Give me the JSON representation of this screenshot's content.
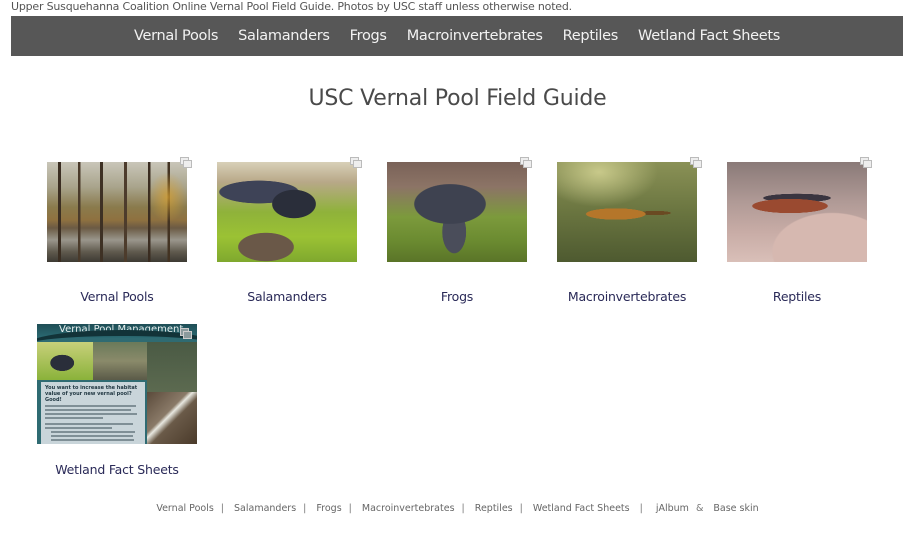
{
  "caption": "Upper Susquehanna Coalition Online Vernal Pool Field Guide. Photos by USC staff unless otherwise noted.",
  "nav": {
    "items": [
      {
        "label": "Vernal Pools"
      },
      {
        "label": "Salamanders"
      },
      {
        "label": "Frogs"
      },
      {
        "label": "Macroinvertebrates"
      },
      {
        "label": "Reptiles"
      },
      {
        "label": "Wetland Fact Sheets"
      }
    ]
  },
  "page_title": "USC Vernal Pool Field Guide",
  "albums": [
    {
      "label": "Vernal Pools",
      "image": "forest pool scene",
      "icon": "album-stack-icon"
    },
    {
      "label": "Salamanders",
      "image": "spotted salamander on moss",
      "icon": "album-stack-icon"
    },
    {
      "label": "Frogs",
      "image": "wood frog on moss",
      "icon": "album-stack-icon"
    },
    {
      "label": "Macroinvertebrates",
      "image": "fairy shrimp in water",
      "icon": "album-stack-icon"
    },
    {
      "label": "Reptiles",
      "image": "five-lined skink on hand",
      "icon": "album-stack-icon"
    },
    {
      "label": "Wetland Fact Sheets",
      "image": "vernal pool management fact sheet",
      "icon": "album-stack-icon",
      "sheet_header": "Vernal Pool Management",
      "sheet_heading": "You want to increase the habitat value of your new vernal pool? Good!"
    }
  ],
  "footer": {
    "links": [
      {
        "label": "Vernal Pools"
      },
      {
        "label": "Salamanders"
      },
      {
        "label": "Frogs"
      },
      {
        "label": "Macroinvertebrates"
      },
      {
        "label": "Reptiles"
      },
      {
        "label": "Wetland Fact Sheets"
      }
    ],
    "separator": "|",
    "credit_1": "jAlbum",
    "credit_joiner": "&",
    "credit_2": "Base skin"
  }
}
